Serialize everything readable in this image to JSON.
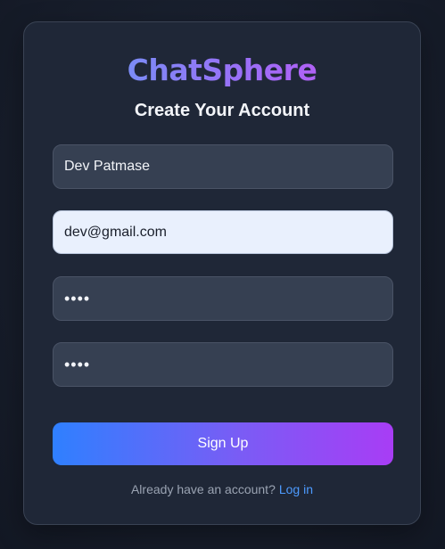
{
  "app": {
    "brand": "ChatSphere",
    "heading": "Create Your Account"
  },
  "form": {
    "name_value": "Dev Patmase",
    "email_value": "dev@gmail.com",
    "password_value": "••••",
    "confirm_password_value": "••••",
    "submit_label": "Sign Up"
  },
  "footer": {
    "prompt": "Already have an account?",
    "login_link": "Log in"
  },
  "colors": {
    "background": "#161c29",
    "card": "#1f2737",
    "input": "#364052",
    "input_focused": "#e9f0fd",
    "link": "#4d9bff",
    "button_gradient_start": "#2f80ff",
    "button_gradient_end": "#a83df5",
    "brand_gradient_start": "#7b8cf6",
    "brand_gradient_end": "#b061f5"
  }
}
